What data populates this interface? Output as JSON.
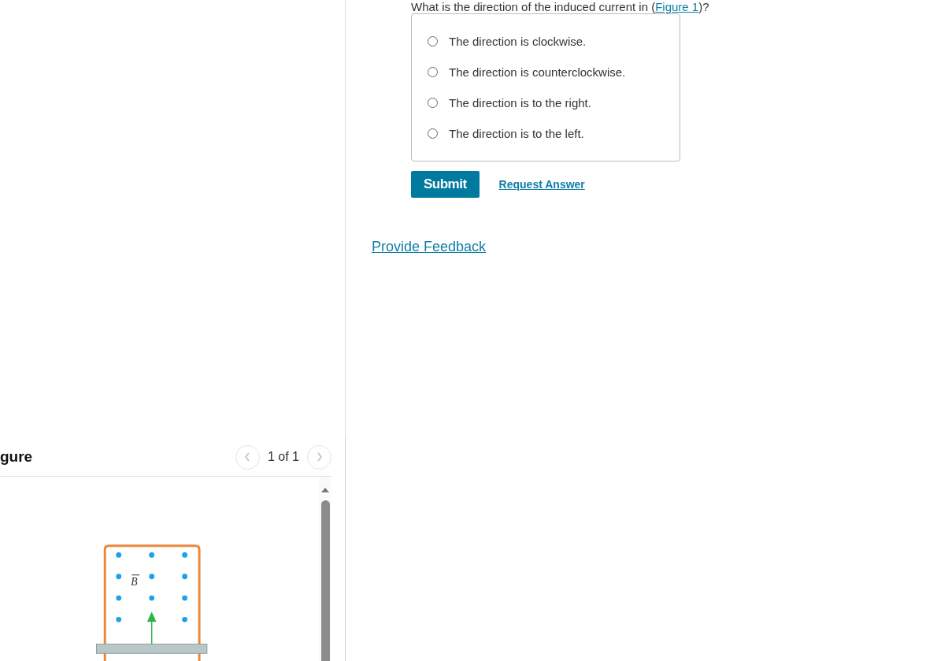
{
  "question": {
    "text": "What is the direction of the induced current in (",
    "link": "Figure 1",
    "end": ")?"
  },
  "options": [
    {
      "label": "The direction is clockwise.",
      "selected": false
    },
    {
      "label": "The direction is counterclockwise.",
      "selected": false
    },
    {
      "label": "The direction is to the right.",
      "selected": false
    },
    {
      "label": "The direction is to the left.",
      "selected": false
    }
  ],
  "buttons": {
    "submit": "Submit",
    "request": "Request Answer"
  },
  "feedback_link": "Provide Feedback",
  "figure_panel": {
    "title": "gure",
    "pager": "1 of 1",
    "field_label": "B"
  }
}
